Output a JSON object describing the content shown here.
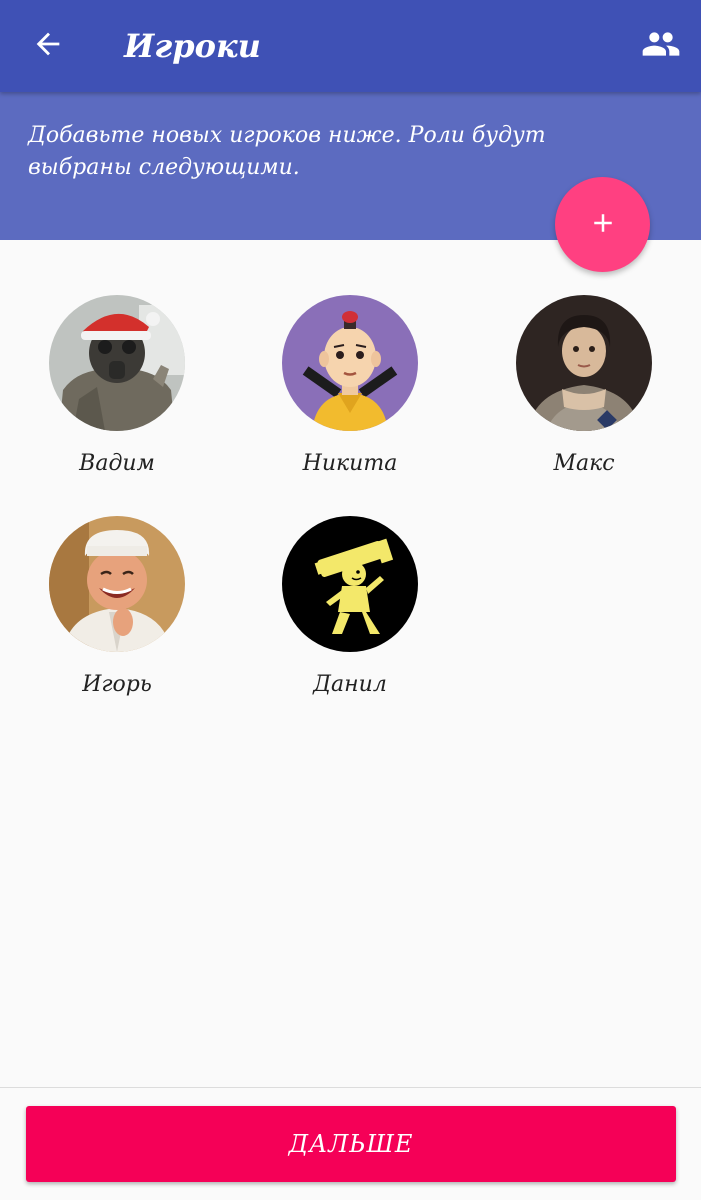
{
  "appbar": {
    "title": "Игроки",
    "back_icon": "arrow-left-icon",
    "group_icon": "people-icon",
    "color": "#3f51b5"
  },
  "banner": {
    "text": "Добавьте новых игроков ниже. Роли будут выбраны следующими.",
    "color": "#5c6bc0"
  },
  "fab": {
    "icon": "plus-icon",
    "color": "#ff4081"
  },
  "players": [
    {
      "name": "Вадим",
      "avatar": "gas-mask-soldier-santa-hat"
    },
    {
      "name": "Никита",
      "avatar": "cartoon-monk-boy"
    },
    {
      "name": "Макс",
      "avatar": "portrait-empress"
    },
    {
      "name": "Игорь",
      "avatar": "smiling-chef"
    },
    {
      "name": "Данил",
      "avatar": "vault-boy-bazooka"
    }
  ],
  "footer": {
    "next_label": "ДАЛЬШЕ",
    "color": "#f50057"
  }
}
